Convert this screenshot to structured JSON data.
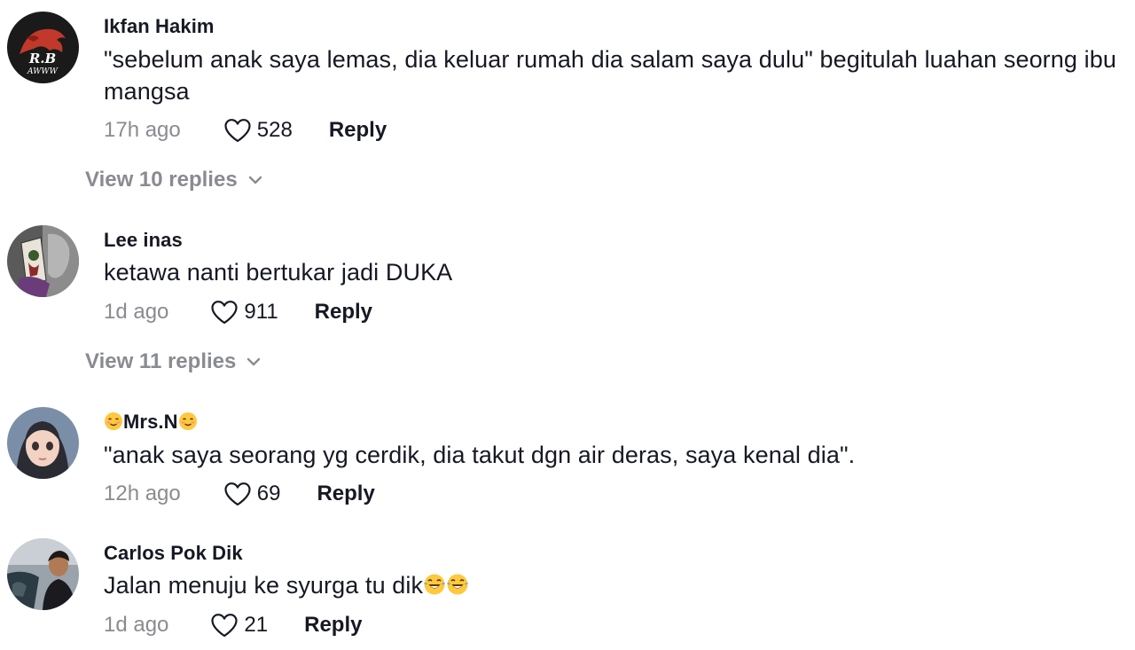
{
  "comments": [
    {
      "username": "Ikfan Hakim",
      "text": "\"sebelum anak saya lemas, dia keluar rumah dia salam saya dulu\" begitulah luahan seorng ibu mangsa",
      "time": "17h ago",
      "likes": "528",
      "reply_label": "Reply",
      "view_replies": "View 10 replies"
    },
    {
      "username": "Lee inas",
      "text": "ketawa nanti bertukar jadi DUKA",
      "time": "1d ago",
      "likes": "911",
      "reply_label": "Reply",
      "view_replies": "View 11 replies"
    },
    {
      "username": "Mrs.N",
      "username_emoji": "☺️",
      "text": "\"anak saya seorang yg cerdik, dia takut dgn air deras, saya kenal dia\".",
      "time": "12h ago",
      "likes": "69",
      "reply_label": "Reply"
    },
    {
      "username": "Carlos Pok Dik",
      "text": "Jalan menuju ke syurga tu dik",
      "text_emoji": "😂😂",
      "time": "1d ago",
      "likes": "21",
      "reply_label": "Reply"
    }
  ],
  "icons": {
    "like": "heart-outline-icon",
    "expand": "chevron-down-icon"
  },
  "colors": {
    "primary_text": "#161823",
    "secondary_text": "#8a8b91"
  }
}
